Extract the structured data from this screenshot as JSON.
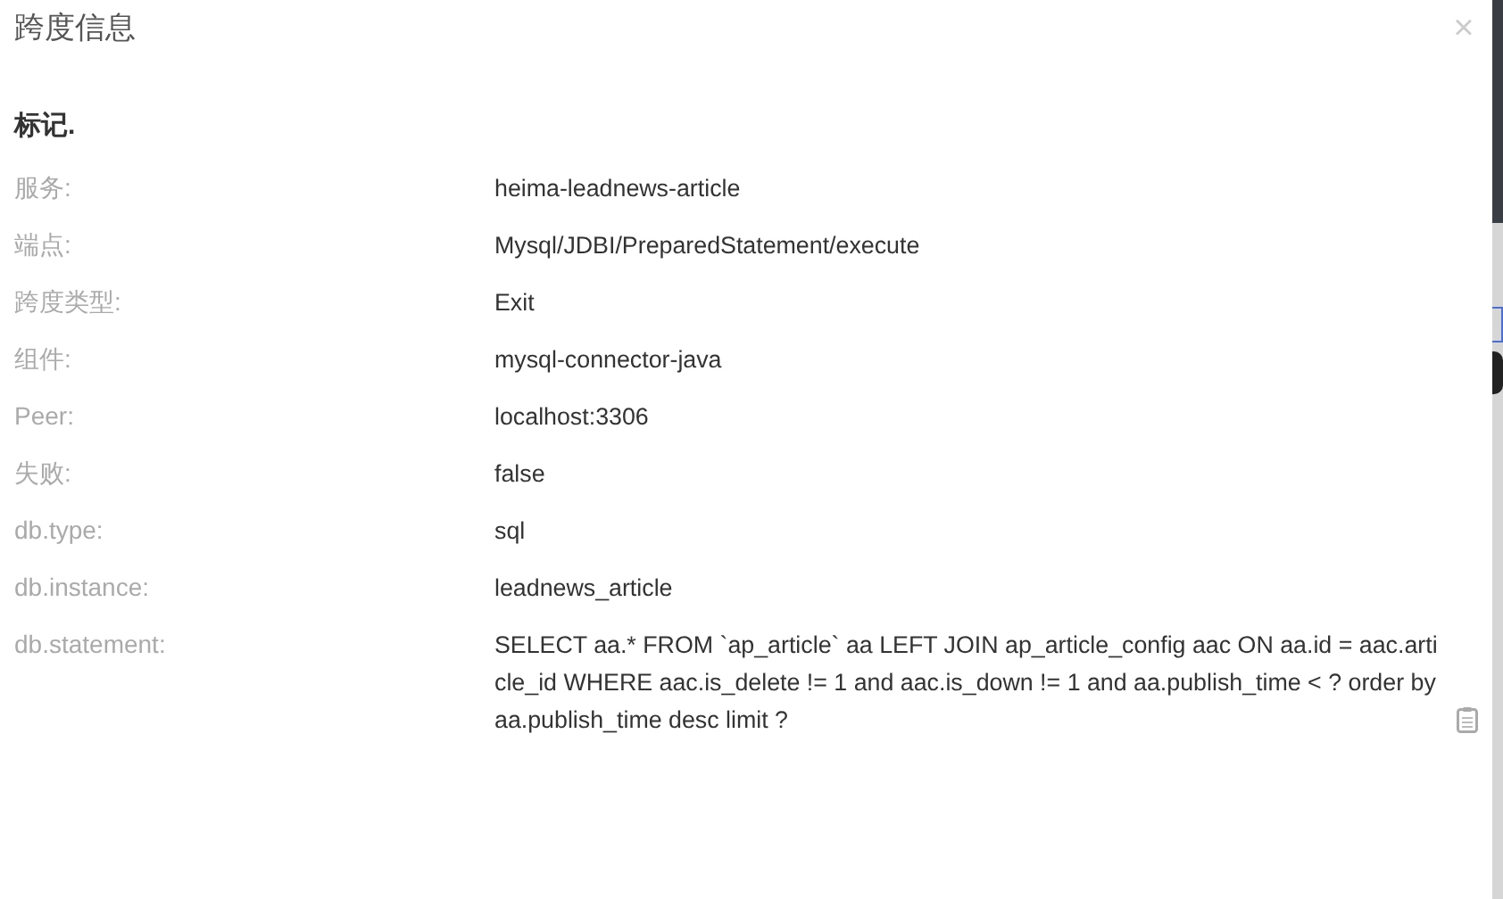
{
  "dialog": {
    "title": "跨度信息",
    "close": "×"
  },
  "section_title": "标记.",
  "fields": [
    {
      "label": "服务:",
      "value": "heima-leadnews-article"
    },
    {
      "label": "端点:",
      "value": "Mysql/JDBI/PreparedStatement/execute"
    },
    {
      "label": "跨度类型:",
      "value": "Exit"
    },
    {
      "label": "组件:",
      "value": "mysql-connector-java"
    },
    {
      "label": "Peer:",
      "value": "localhost:3306"
    },
    {
      "label": "失败:",
      "value": "false"
    },
    {
      "label": "db.type:",
      "value": "sql"
    },
    {
      "label": "db.instance:",
      "value": "leadnews_article"
    },
    {
      "label": "db.statement:",
      "value": "SELECT aa.* FROM `ap_article` aa LEFT JOIN ap_article_config aac ON aa.id = aac.article_id WHERE aac.is_delete != 1 and aac.is_down != 1 and aa.publish_time < ? order by aa.publish_time desc limit ?",
      "copyable": true
    }
  ]
}
